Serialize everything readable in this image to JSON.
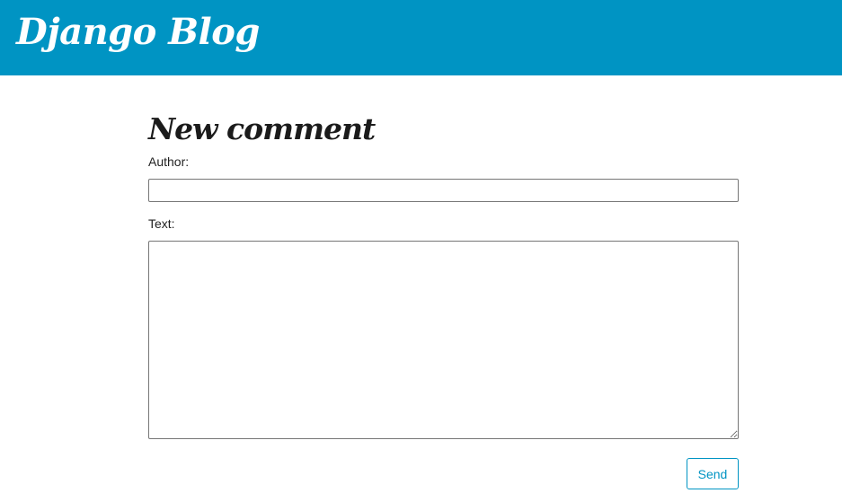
{
  "header": {
    "site_title": "Django Blog",
    "background_color": "#0094c3"
  },
  "main": {
    "page_title": "New comment",
    "form": {
      "author_label": "Author:",
      "author_value": "",
      "text_label": "Text:",
      "text_value": "",
      "submit_label": "Send"
    }
  }
}
